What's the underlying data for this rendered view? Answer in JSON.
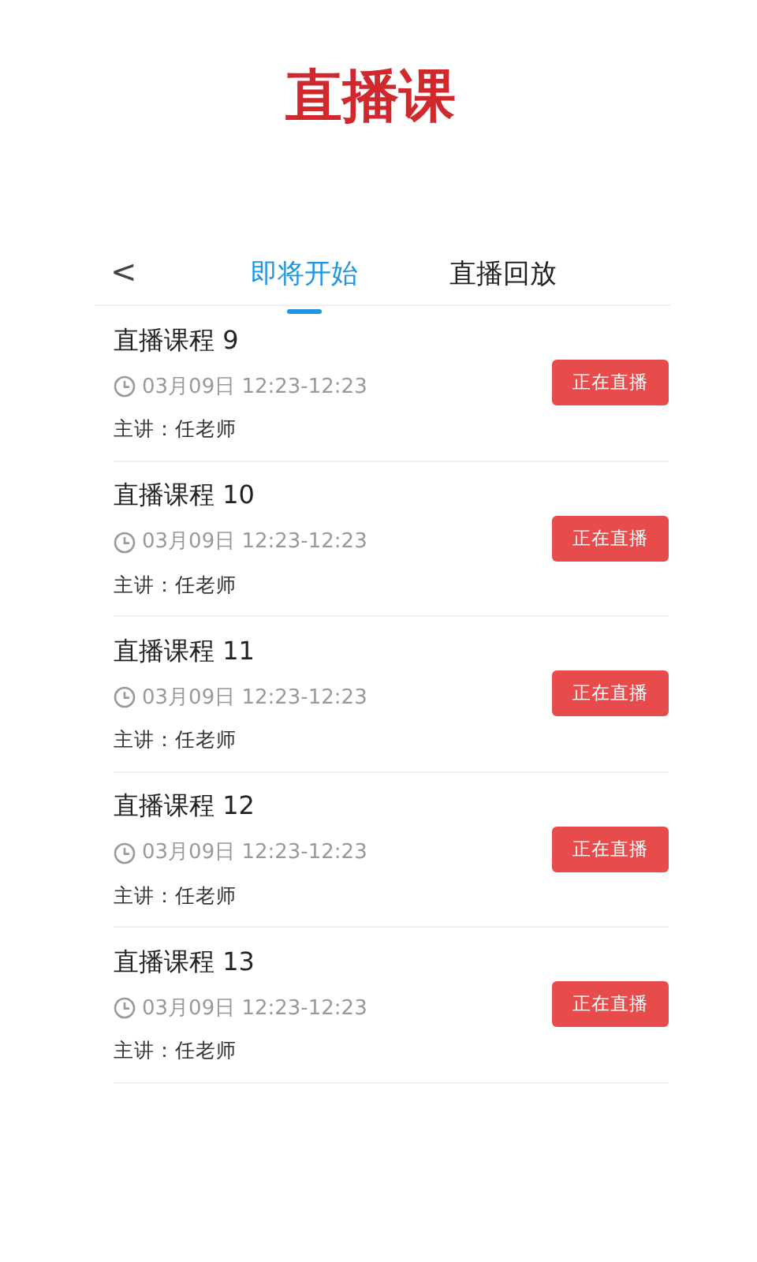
{
  "header": {
    "title": "直播课"
  },
  "nav": {
    "back": "<",
    "tabs": [
      {
        "label": "即将开始",
        "selected": true
      },
      {
        "label": "直播回放",
        "selected": false
      }
    ]
  },
  "courses": [
    {
      "title": "直播课程 9",
      "time": "03月09日 12:23-12:23",
      "teacher": "主讲：任老师",
      "button": "正在直播"
    },
    {
      "title": "直播课程 10",
      "time": "03月09日 12:23-12:23",
      "teacher": "主讲：任老师",
      "button": "正在直播"
    },
    {
      "title": "直播课程 11",
      "time": "03月09日 12:23-12:23",
      "teacher": "主讲：任老师",
      "button": "正在直播"
    },
    {
      "title": "直播课程 12",
      "time": "03月09日 12:23-12:23",
      "teacher": "主讲：任老师",
      "button": "正在直播"
    },
    {
      "title": "直播课程 13",
      "time": "03月09日 12:23-12:23",
      "teacher": "主讲：任老师",
      "button": "正在直播"
    }
  ]
}
